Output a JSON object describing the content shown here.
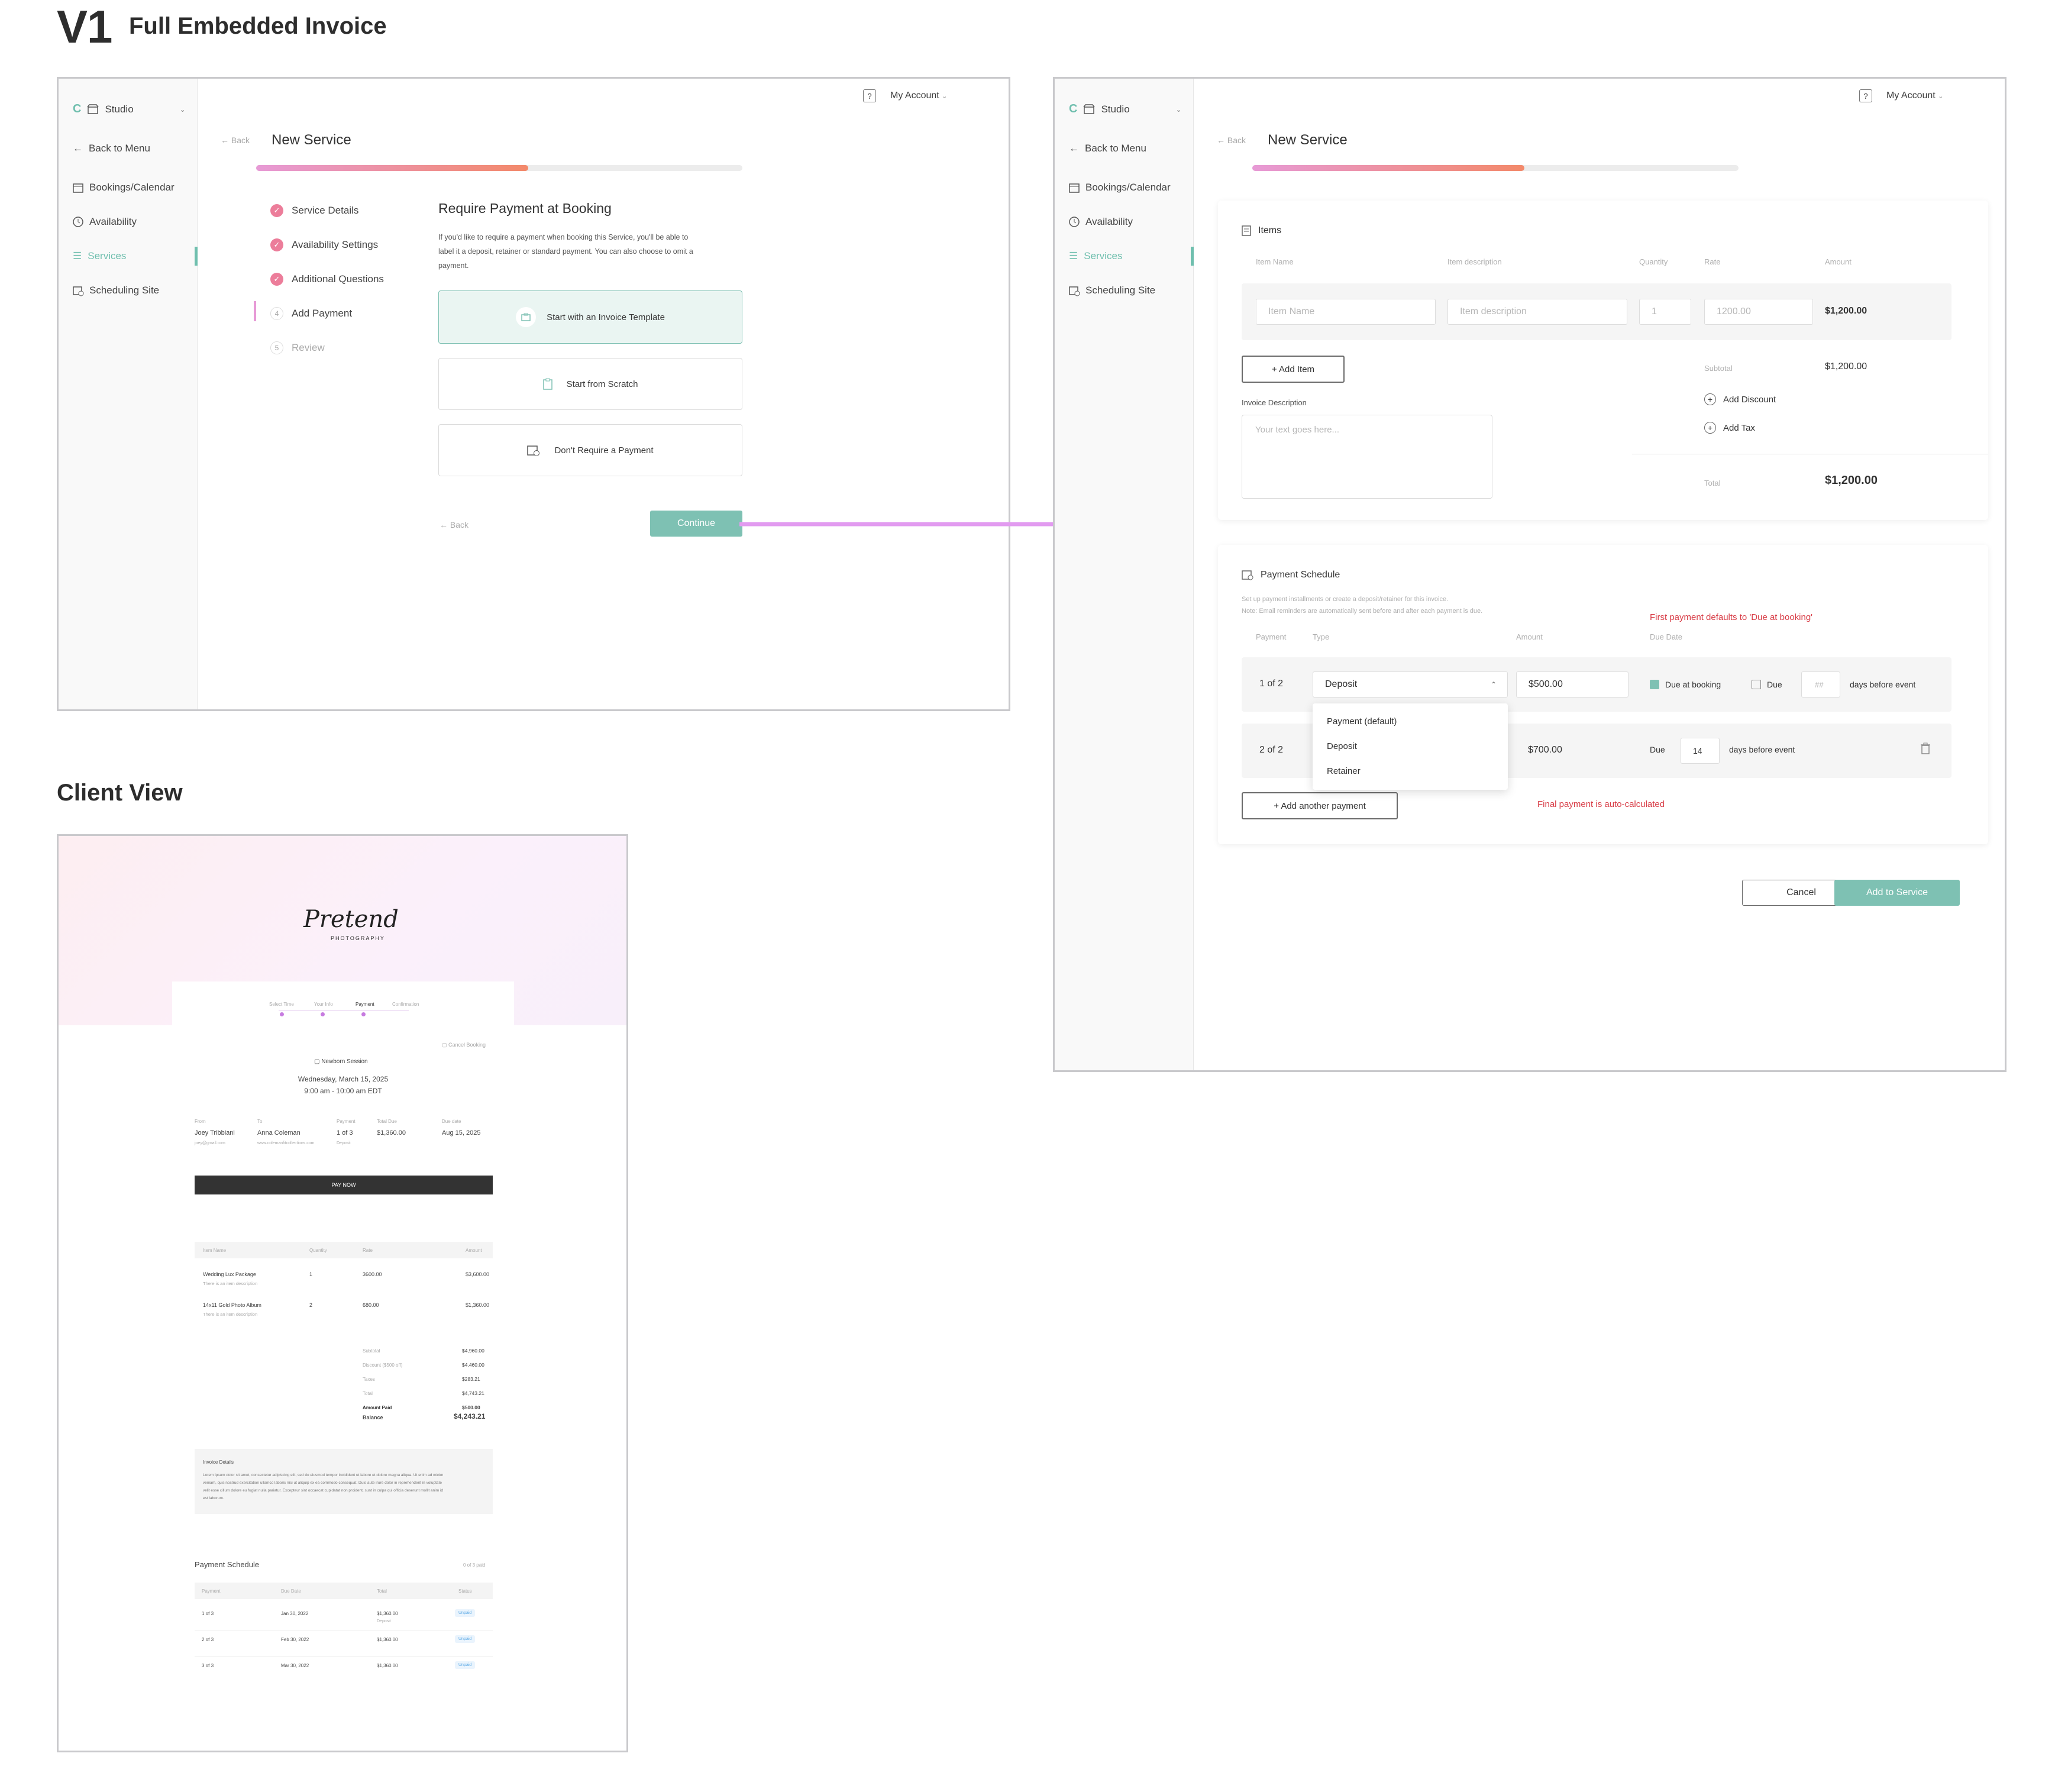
{
  "page": {
    "version": "V1",
    "title": "Full Embedded Invoice",
    "client_view_title": "Client View"
  },
  "sidebar": {
    "studio": "Studio",
    "back_to_menu": "Back to Menu",
    "items": [
      "Bookings/Calendar",
      "Availability",
      "Services",
      "Scheduling Site"
    ]
  },
  "topbar": {
    "account": "My Account"
  },
  "screen1": {
    "back": "Back",
    "title": "New Service",
    "progress_fraction": 0.56,
    "steps": [
      {
        "label": "Service Details",
        "state": "done"
      },
      {
        "label": "Availability Settings",
        "state": "done"
      },
      {
        "label": "Additional Questions",
        "state": "done"
      },
      {
        "num": "4",
        "label": "Add Payment",
        "state": "current"
      },
      {
        "num": "5",
        "label": "Review",
        "state": "todo"
      }
    ],
    "heading": "Require Payment at Booking",
    "desc_lines": [
      "If you'd like to require a payment when booking this Service, you'll be able to",
      "label it a deposit, retainer or standard payment. You can also choose to omit a",
      "payment."
    ],
    "options": [
      "Start with an Invoice Template",
      "Start from Scratch",
      "Don't Require a Payment"
    ],
    "footer_back": "Back",
    "continue": "Continue"
  },
  "screen2": {
    "back": "Back",
    "title": "New Service",
    "progress_fraction": 0.56,
    "items_card": {
      "title": "Items",
      "headers": [
        "Item Name",
        "Item description",
        "Quantity",
        "Rate",
        "Amount"
      ],
      "row": {
        "name_ph": "Item Name",
        "desc_ph": "Item description",
        "qty": "1",
        "rate": "1200.00",
        "amount": "$1,200.00"
      },
      "add_item": "+ Add Item",
      "subtotal_label": "Subtotal",
      "subtotal": "$1,200.00",
      "add_discount": "Add Discount",
      "add_tax": "Add Tax",
      "invoice_desc_label": "Invoice Description",
      "invoice_desc_ph": "Your text goes here...",
      "total_label": "Total",
      "total": "$1,200.00"
    },
    "schedule_card": {
      "title": "Payment Schedule",
      "hint1": "Set up payment installments or create a deposit/retainer for this invoice.",
      "hint2": "Note: Email reminders are automatically sent before and after each payment is due.",
      "note_first": "First payment defaults to 'Due at booking'",
      "headers": [
        "Payment",
        "Type",
        "Amount",
        "Due Date"
      ],
      "row1": {
        "label": "1 of 2",
        "type": "Deposit",
        "amount": "$500.00",
        "due_at_booking": "Due at booking",
        "due": "Due",
        "days_ph": "##",
        "days_label": "days before event"
      },
      "row2": {
        "label": "2 of 2",
        "amount": "$700.00",
        "due": "Due",
        "days": "14",
        "days_label": "days before event"
      },
      "dropdown": [
        "Payment (default)",
        "Deposit",
        "Retainer"
      ],
      "add_payment": "+ Add another payment",
      "note_final": "Final payment is auto-calculated"
    },
    "cancel": "Cancel",
    "add_to_service": "Add to Service"
  },
  "client": {
    "logo_main": "Pretend",
    "logo_sub": "PHOTOGRAPHY",
    "steps": [
      "Select Time",
      "Your Info",
      "Payment",
      "Confirmation"
    ],
    "cancel_booking": "Cancel Booking",
    "session": "Newborn Session",
    "date": "Wednesday, March 15, 2025",
    "time": "9:00 am - 10:00 am EDT",
    "info_labels": [
      "From",
      "To",
      "Payment",
      "Total Due",
      "Due date"
    ],
    "from_name": "Joey Tribbiani",
    "from_email": "joey@gmail.com",
    "to_name": "Anna Coleman",
    "to_email": "www.colemanfitcollections.com",
    "payment": "1 of 3",
    "payment_type": "Deposit",
    "total_due": "$1,360.00",
    "due_date": "Aug 15, 2025",
    "pay_now": "PAY NOW",
    "table_headers": [
      "Item Name",
      "Quantity",
      "Rate",
      "Amount"
    ],
    "items": [
      {
        "name": "Wedding Lux Package",
        "desc": "There is an item description",
        "qty": "1",
        "rate": "3600.00",
        "amount": "$3,600.00"
      },
      {
        "name": "14x11 Gold Photo Album",
        "desc": "There is an item description",
        "qty": "2",
        "rate": "680.00",
        "amount": "$1,360.00"
      }
    ],
    "totals": [
      {
        "label": "Subtotal",
        "value": "$4,960.00"
      },
      {
        "label": "Discount ($500 off)",
        "value": "$4,460.00"
      },
      {
        "label": "Taxes",
        "value": "$283.21"
      },
      {
        "label": "Total",
        "value": "$4,743.21"
      },
      {
        "label": "Amount Paid",
        "value": "$500.00"
      }
    ],
    "balance_label": "Balance",
    "balance": "$4,243.21",
    "details_title": "Invoice Details",
    "details_lines": [
      "Lorem ipsum dolor sit amet, consectetur adipiscing elit, sed do eiusmod tempor incididunt ut labore et dolore magna aliqua. Ut enim ad minim",
      "veniam, quis nostrud exercitation ullamco laboris nisi ut aliquip ex ea commodo consequat. Duis aute irure dolor in reprehenderit in voluptate",
      "velit esse cillum dolore eu fugiat nulla pariatur. Excepteur sint occaecat cupidatat non proident, sunt in culpa qui officia deserunt mollit anim id",
      "est laborum."
    ],
    "schedule_title": "Payment Schedule",
    "schedule_count": "0 of 3 paid",
    "schedule_headers": [
      "Payment",
      "Due Date",
      "Total",
      "Status"
    ],
    "schedule_rows": [
      {
        "payment": "1 of 3",
        "date": "Jan 30, 2022",
        "total": "$1,360.00",
        "sub": "Deposit",
        "status": "Unpaid"
      },
      {
        "payment": "2 of 3",
        "date": "Feb 30, 2022",
        "total": "$1,360.00",
        "sub": "",
        "status": "Unpaid"
      },
      {
        "payment": "3 of 3",
        "date": "Mar 30, 2022",
        "total": "$1,360.00",
        "sub": "",
        "status": "Unpaid"
      }
    ]
  },
  "colors": {
    "accent": "#7ec1b3",
    "arrow": "#e29bf0",
    "error": "#d83b45",
    "progress_start": "#e79ad6",
    "progress_end": "#f3896a"
  }
}
